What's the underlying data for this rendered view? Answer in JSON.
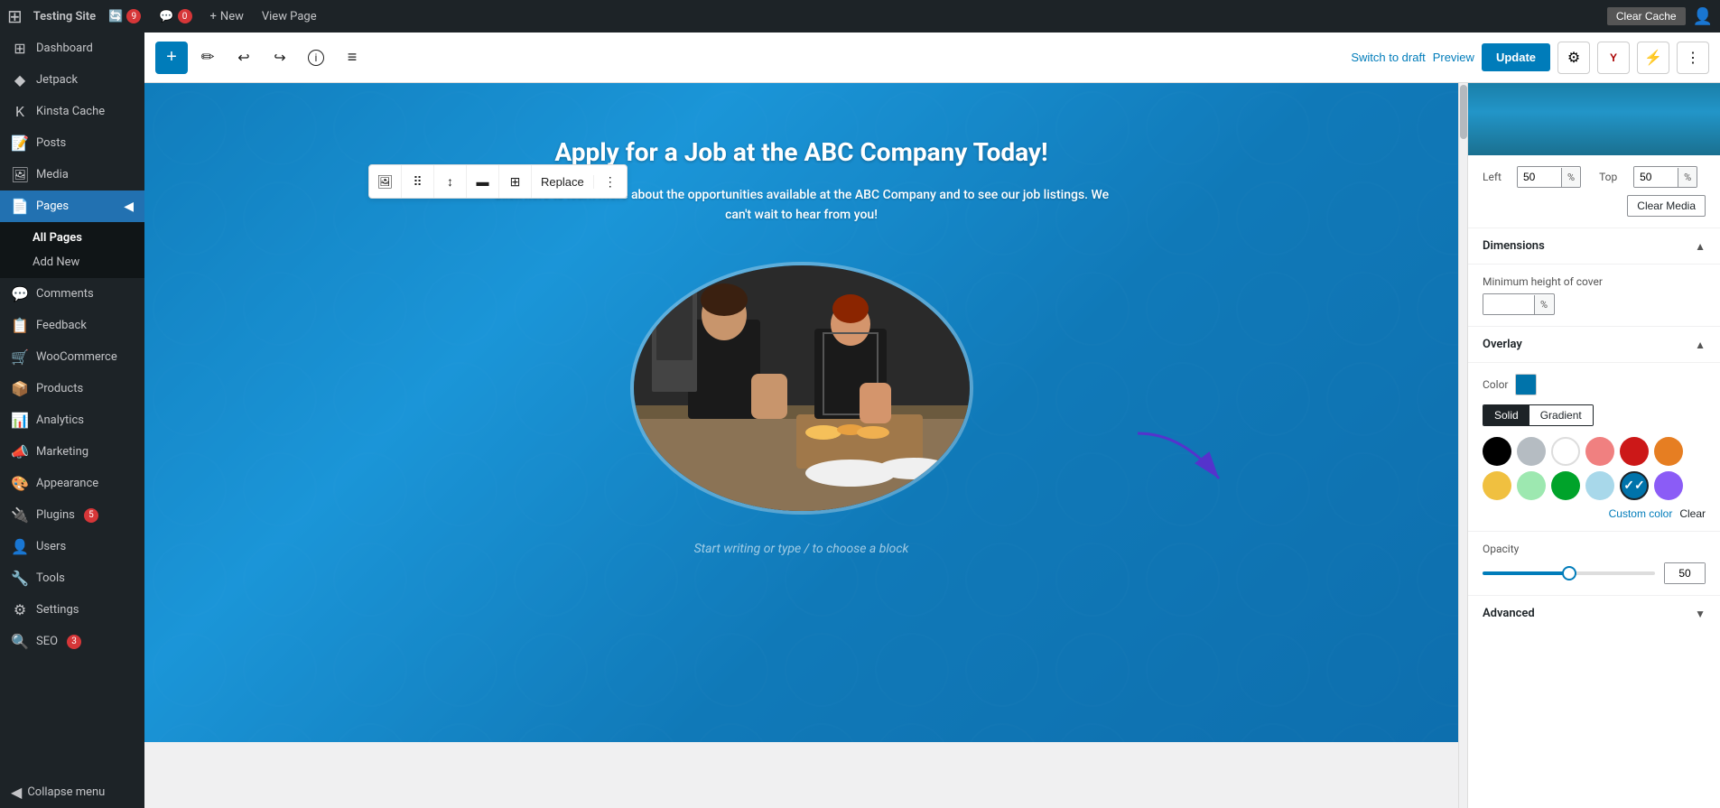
{
  "admin_bar": {
    "site_name": "Testing Site",
    "updates_count": "9",
    "comments_count": "0",
    "new_label": "New",
    "view_page_label": "View Page",
    "clear_cache_label": "Clear Cache"
  },
  "sidebar": {
    "items": [
      {
        "id": "dashboard",
        "label": "Dashboard",
        "icon": "⊞"
      },
      {
        "id": "jetpack",
        "label": "Jetpack",
        "icon": "◆"
      },
      {
        "id": "kinsta",
        "label": "Kinsta Cache",
        "icon": "K"
      },
      {
        "id": "posts",
        "label": "Posts",
        "icon": "📝"
      },
      {
        "id": "media",
        "label": "Media",
        "icon": "🖼"
      },
      {
        "id": "pages",
        "label": "Pages",
        "icon": "📄",
        "active": true
      },
      {
        "id": "comments",
        "label": "Comments",
        "icon": "💬"
      },
      {
        "id": "feedback",
        "label": "Feedback",
        "icon": "📋"
      },
      {
        "id": "woocommerce",
        "label": "WooCommerce",
        "icon": "🛒"
      },
      {
        "id": "products",
        "label": "Products",
        "icon": "📦"
      },
      {
        "id": "analytics",
        "label": "Analytics",
        "icon": "📊"
      },
      {
        "id": "marketing",
        "label": "Marketing",
        "icon": "📣"
      },
      {
        "id": "appearance",
        "label": "Appearance",
        "icon": "🎨"
      },
      {
        "id": "plugins",
        "label": "Plugins",
        "icon": "🔌",
        "badge": "5"
      },
      {
        "id": "users",
        "label": "Users",
        "icon": "👤"
      },
      {
        "id": "tools",
        "label": "Tools",
        "icon": "🔧"
      },
      {
        "id": "settings",
        "label": "Settings",
        "icon": "⚙"
      },
      {
        "id": "seo",
        "label": "SEO",
        "icon": "🔍",
        "badge": "3",
        "badge_color": "orange"
      }
    ],
    "pages_sub": {
      "all_pages": "All Pages",
      "add_new": "Add New"
    },
    "collapse_label": "Collapse menu"
  },
  "gutenberg": {
    "add_block_title": "Add block",
    "tools_title": "Tools",
    "undo_title": "Undo",
    "redo_title": "Redo",
    "info_title": "Document info",
    "list_view_title": "List view",
    "switch_draft": "Switch to draft",
    "preview": "Preview",
    "update": "Update",
    "settings_title": "Settings",
    "yoast_title": "Yoast SEO",
    "boost_title": "Boost"
  },
  "block_toolbar": {
    "image_icon": "🖼",
    "drag_icon": "⠿",
    "move_up_down": "↕",
    "align_center": "≡",
    "fullwidth": "⊞",
    "replace": "Replace",
    "more": "⋮"
  },
  "cover_block": {
    "title": "Apply for a Job at the ABC Company Today!",
    "description": "Click here to learn more about the opportunities available at the ABC Company and to see our job listings. We can't wait to hear from you!",
    "start_writing": "Start writing or type / to choose a block"
  },
  "right_panel": {
    "position": {
      "left_label": "Left",
      "left_value": "50",
      "left_unit": "%",
      "top_label": "Top",
      "top_value": "50",
      "top_unit": "%"
    },
    "clear_media": "Clear Media",
    "dimensions": {
      "heading": "Dimensions",
      "min_height_label": "Minimum height of cover",
      "min_height_value": "",
      "min_height_unit": "%"
    },
    "overlay": {
      "heading": "Overlay",
      "color_label": "Color",
      "color_value": "#0073aa",
      "solid_tab": "Solid",
      "gradient_tab": "Gradient",
      "palette": [
        {
          "id": "black",
          "color": "#000000",
          "selected": false
        },
        {
          "id": "gray",
          "color": "#b5bcc2",
          "selected": false
        },
        {
          "id": "white",
          "color": "#ffffff",
          "selected": false
        },
        {
          "id": "pink",
          "color": "#f08080",
          "selected": false
        },
        {
          "id": "red",
          "color": "#cc1818",
          "selected": false
        },
        {
          "id": "orange",
          "color": "#e67e22",
          "selected": false
        },
        {
          "id": "yellow",
          "color": "#f0c040",
          "selected": false
        },
        {
          "id": "light-green",
          "color": "#9de8b0",
          "selected": false
        },
        {
          "id": "green",
          "color": "#00a32a",
          "selected": false
        },
        {
          "id": "light-blue",
          "color": "#a8d8ea",
          "selected": false
        },
        {
          "id": "blue",
          "color": "#0073aa",
          "selected": true
        },
        {
          "id": "purple",
          "color": "#8b5cf6",
          "selected": false
        }
      ],
      "custom_color": "Custom color",
      "clear": "Clear"
    },
    "opacity": {
      "label": "Opacity",
      "value": "50",
      "slider_percent": 50
    },
    "advanced": {
      "label": "Advanced"
    }
  }
}
